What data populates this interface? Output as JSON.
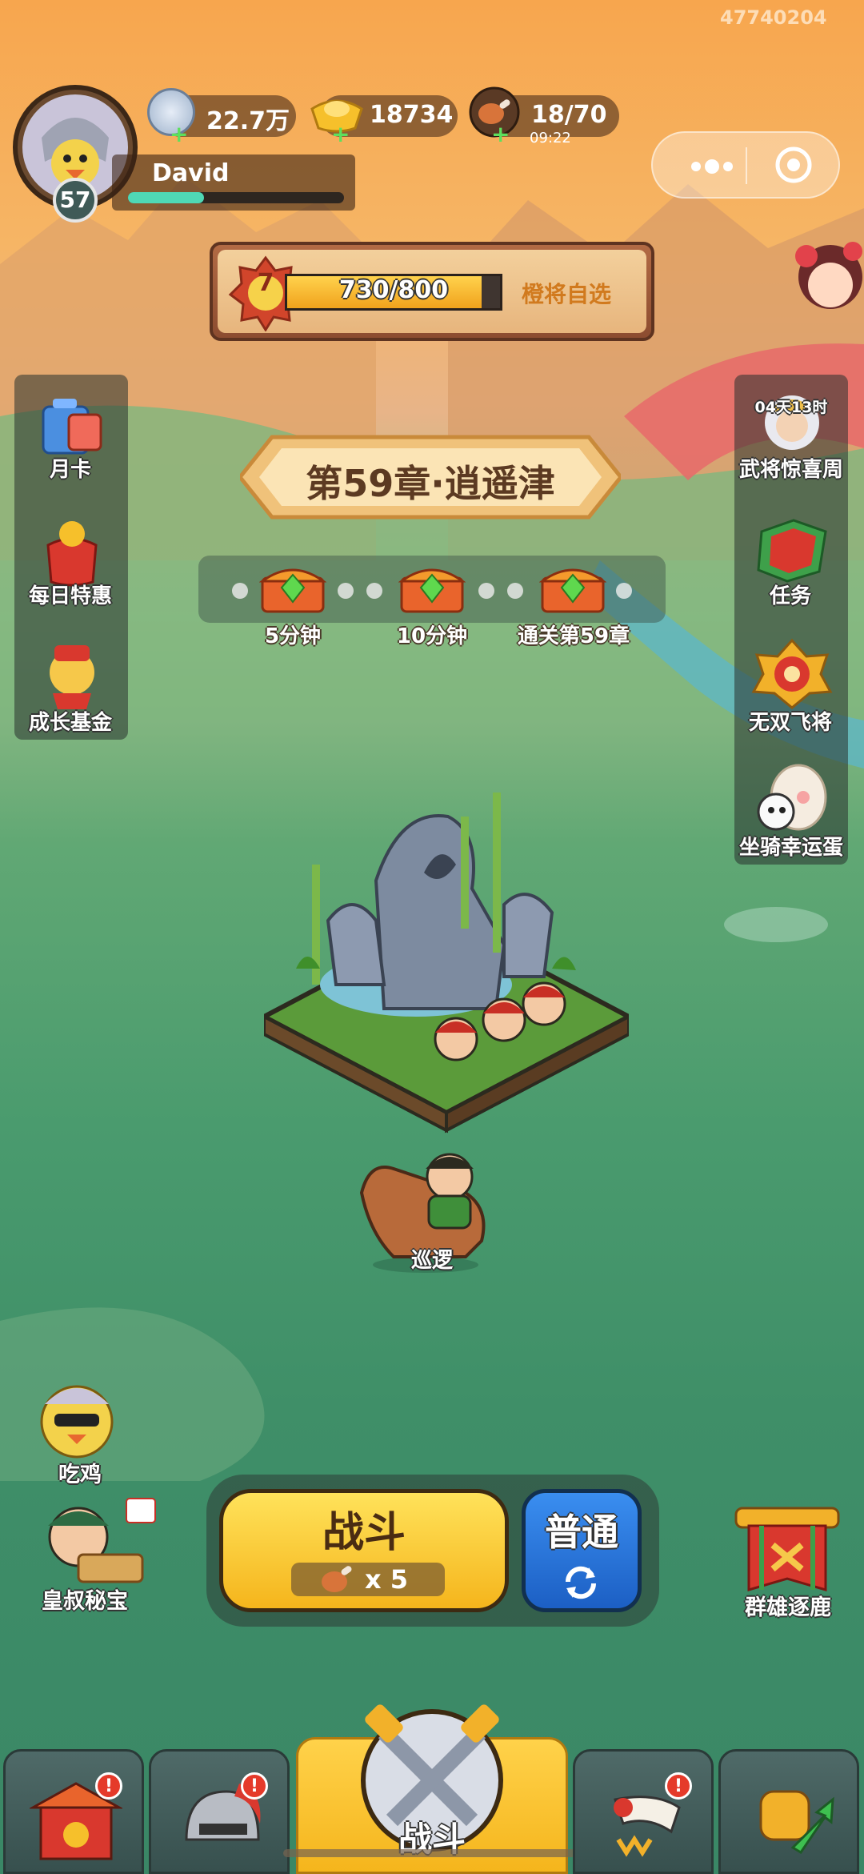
{
  "watermark": "47740204",
  "player": {
    "level": "57",
    "name": "David",
    "xp_fraction": 0.35
  },
  "resources": {
    "silver": "22.7万",
    "gold": "18734",
    "stamina": "18/70",
    "stamina_timer": "09:22"
  },
  "vip": {
    "level": "7",
    "progress_text": "730/800",
    "progress_fraction": 0.9125,
    "reward_label": "橙将自选"
  },
  "chapter": {
    "title": "第59章·逍遥津"
  },
  "chest_rewards": [
    {
      "label": "5分钟"
    },
    {
      "label": "10分钟"
    },
    {
      "label": "通关第59章"
    }
  ],
  "left_menu": [
    {
      "label": "月卡",
      "icon": "monthly-card-icon"
    },
    {
      "label": "每日特惠",
      "icon": "gift-bag-icon"
    },
    {
      "label": "成长基金",
      "icon": "growth-fund-icon"
    }
  ],
  "right_menu": [
    {
      "label": "武将惊喜周",
      "timer": "04天13时",
      "icon": "general-surprise-icon"
    },
    {
      "label": "任务",
      "icon": "quest-book-icon"
    },
    {
      "label": "无双飞将",
      "icon": "peerless-general-icon"
    },
    {
      "label": "坐骑幸运蛋",
      "icon": "lucky-egg-icon"
    }
  ],
  "hero_status": "巡逻",
  "bottom_left": [
    {
      "label": "吃鸡",
      "icon": "chicken-icon"
    },
    {
      "label": "皇叔秘宝",
      "icon": "treasure-icon"
    }
  ],
  "battle": {
    "label": "战斗",
    "cost": "x 5",
    "mode": "普通"
  },
  "bottom_right": {
    "label": "群雄逐鹿",
    "icon": "banner-icon"
  },
  "nav": [
    {
      "icon": "city-gate-icon",
      "badge": "!"
    },
    {
      "icon": "helmet-icon",
      "badge": "!"
    },
    {
      "label": "战斗",
      "icon": "crossed-swords-icon"
    },
    {
      "icon": "horn-icon",
      "badge": "!"
    },
    {
      "icon": "fist-upgrade-icon"
    }
  ],
  "colors": {
    "accent_orange": "#f6a03b",
    "battle_yellow": "#f7c531",
    "mode_blue": "#2f7fe0",
    "badge_red": "#e53a2a"
  }
}
